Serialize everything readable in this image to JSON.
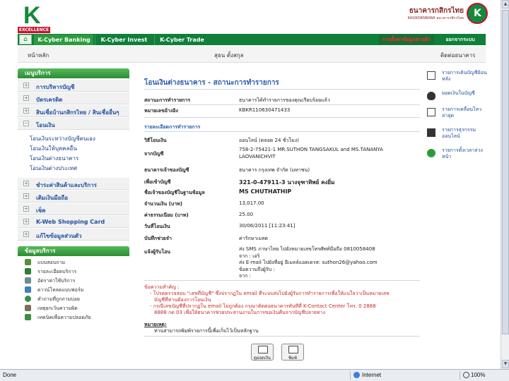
{
  "header": {
    "logo_tag": "EXCELLENCE",
    "bank_name_th": "ธนาคารกสิกรไทย",
    "bank_name_en": "KASIKORNBANK ธนาคารกสิกรไทย"
  },
  "nav": {
    "tabs": [
      "K-Cyber Banking",
      "K-Cyber Invest",
      "K-Cyber Trade"
    ],
    "settings": "การตั้งค่าข้อมูลส่วนตัว",
    "logout": "ออกจากระบบ"
  },
  "subbar": {
    "home": "หน้าหลัก",
    "user": "สุธน ตั้งสกุล",
    "contact": "ติดต่อธนาคาร"
  },
  "sidebar": {
    "menu_title": "เมนูบริการ",
    "items": [
      "การบริหารบัญชี",
      "บัตรเครดิต",
      "สินเชื่อบ้านกสิกรไทย / สินเชื่ออื่นๆ",
      "โอนเงิน",
      "ชำระค่าสินค้าและบริการ",
      "เติมเงินมือถือ",
      "เช็ค",
      "K-Web Shopping Card",
      "แก้ไขข้อมูลส่วนตัว"
    ],
    "transfer_sub": [
      "โอนเงินระหว่างบัญชีตนเอง",
      "โอนเงินให้บุคคลอื่น",
      "โอนเงินต่างธนาคาร",
      "โอนเงินต่างประเทศ"
    ],
    "info_title": "ข้อมูลบริการ",
    "info_items": [
      "แบบสอบถาม",
      "รายละเอียดบริการ",
      "อัตราค่าใช้บริการ",
      "ดาวน์โหลดแบบฟอร์ม",
      "คำถามที่ถูกถามบ่อย",
      "เหตุยกเว้นความผิด",
      "เทคนิคเพื่อความปลอดภัย"
    ]
  },
  "main": {
    "title": "โอนเงินต่างธนาคาร - สถานะการทำรายการ",
    "status_label": "สถานะการทำรายการ",
    "status_value": "ธนาคารได้ทำรายการของคุณเรียบร้อยแล้ว",
    "ref_label": "หมายเลขอ้างอิง",
    "ref_value": "KBKR110630471433",
    "detail_head": "รายละเอียดการทำรายการ",
    "method_label": "วิธีโอนเงิน",
    "method_value": "ออนไลน์ (ตลอด 24 ชั่วโมง)",
    "from_label": "จากบัญชี",
    "from_value_1": "758-2-75421-1 MR.SUTHON TANGSAKUL and MS.TANANYA",
    "from_value_2": "LAOVANICHVIT",
    "bank_label": "ธนาคารเจ้าของบัญชี",
    "bank_value": "ธนาคาร กรุงเทพ จำกัด (มหาชน)",
    "to_label": "เพื่อเข้าบัญชี",
    "to_value": "321-0-47911-3 นางจุฑาทิพย์ คงยิ่ม",
    "name_label": "ชื่อเจ้าของบัญชีในฐานข้อมูล",
    "name_value": "MS CHUTHATHIP",
    "amount_label": "จำนวนเงิน (บาท)",
    "amount_value": "13,017.00",
    "fee_label": "ค่าธรรมเนียม (บาท)",
    "fee_value": "25.00",
    "date_label": "วันที่โอนเงิน",
    "date_value": "30/06/2011 [11:23:41]",
    "memo_label": "บันทึกช่วยจำ",
    "memo_value": "ค่ารักษาเมสต",
    "notify_label": "แจ้งผู้รับโอน",
    "notify_1": "ส่ง SMS ภาษาไทย ไปยังหมายเลขโทรศัพท์มือถือ 0810058408",
    "notify_2": "จาก : เอริ",
    "notify_3": "ส่ง E-mail ไปยังที่อยู่ อีเมลล์แอดเดรส: suthon26@yahoo.com",
    "notify_4": "ข้อความถึงผู้รับ :",
    "notify_5": "จาก :",
    "notice_title": "ข้อความสำคัญ :",
    "notice_1": "- โปรดตรวจสอบ \"เลขที่บัญชี\" ซึ่งปรากฏใน email ที่ระบบส่งไปยังผู้รับการทำรายการเพื่อให้แน่ใจว่าเป็นหมายเลข",
    "notice_2": "บัญชีที่ท่านต้องการโอนเงิน",
    "notice_3": "- กรณีเลขบัญชีที่ปรากฏใน email ไม่ถูกต้อง กรุณาติดต่อธนาคารทันทีที่ K-Contact Center โทร. 0 2888",
    "notice_4": "8888 กด 03 เพื่อให้ธนาคารช่วยประสานงานในการขอเงินคืนจากบัญชีปลายทาง",
    "note_title": "หมายเหตุ:",
    "note_text": "ท่านสามารถพิมพ์รายการนี้เพื่อเก็บไว้เป็นหลักฐาน",
    "btn_balance": "ดูยอดเงิน",
    "btn_print": "พิมพ์"
  },
  "right_panel": {
    "items": [
      "รายการเดินบัญชีย้อนหลัง",
      "ยอดเงินในบัญชี",
      "รายการเคลื่อนไหวล่าสุด",
      "รายการธุรกรรมออนไลน์",
      "รายการตั้งเวลาล่วงหน้า"
    ]
  },
  "statusbar": {
    "status": "Done",
    "zone": "Internet",
    "zoom": "100%"
  },
  "colors": {
    "brand_green": "#0f7f3a",
    "title_blue": "#2a5db0",
    "notice_red": "#c62828"
  }
}
